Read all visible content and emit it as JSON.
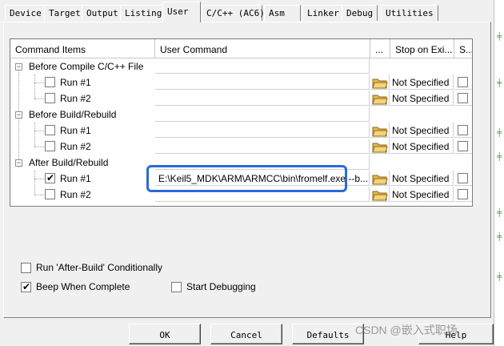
{
  "tabs": [
    "Device",
    "Target",
    "Output",
    "Listing",
    "User",
    "C/C++ (AC6)",
    "Asm",
    "Linker",
    "Debug",
    "Utilities"
  ],
  "active_tab": "User",
  "grid": {
    "headers": {
      "items": "Command Items",
      "command": "User Command",
      "browse": "...",
      "stop": "Stop on Exi...",
      "s": "S..."
    },
    "groups": [
      {
        "label": "Before Compile C/C++ File",
        "runs": [
          {
            "label": "Run #1",
            "checked": false,
            "command": "",
            "stop": "Not Specified"
          },
          {
            "label": "Run #2",
            "checked": false,
            "command": "",
            "stop": "Not Specified"
          }
        ]
      },
      {
        "label": "Before Build/Rebuild",
        "runs": [
          {
            "label": "Run #1",
            "checked": false,
            "command": "",
            "stop": "Not Specified"
          },
          {
            "label": "Run #2",
            "checked": false,
            "command": "",
            "stop": "Not Specified"
          }
        ]
      },
      {
        "label": "After Build/Rebuild",
        "runs": [
          {
            "label": "Run #1",
            "checked": true,
            "command": "E:\\Keil5_MDK\\ARM\\ARMCC\\bin\\fromelf.exe --b...",
            "stop": "Not Specified"
          },
          {
            "label": "Run #2",
            "checked": false,
            "command": "",
            "stop": "Not Specified"
          }
        ]
      }
    ]
  },
  "options": {
    "run_after_build": {
      "label": "Run 'After-Build' Conditionally",
      "checked": false
    },
    "beep": {
      "label": "Beep When Complete",
      "checked": true
    },
    "start_debugging": {
      "label": "Start Debugging",
      "checked": false
    }
  },
  "buttons": {
    "ok": "OK",
    "cancel": "Cancel",
    "defaults": "Defaults",
    "help": "Help"
  },
  "watermark": "CSDN @嵌入式职场",
  "colors": {
    "highlight": "#2a6ad8",
    "folder": "#e8b84a"
  }
}
